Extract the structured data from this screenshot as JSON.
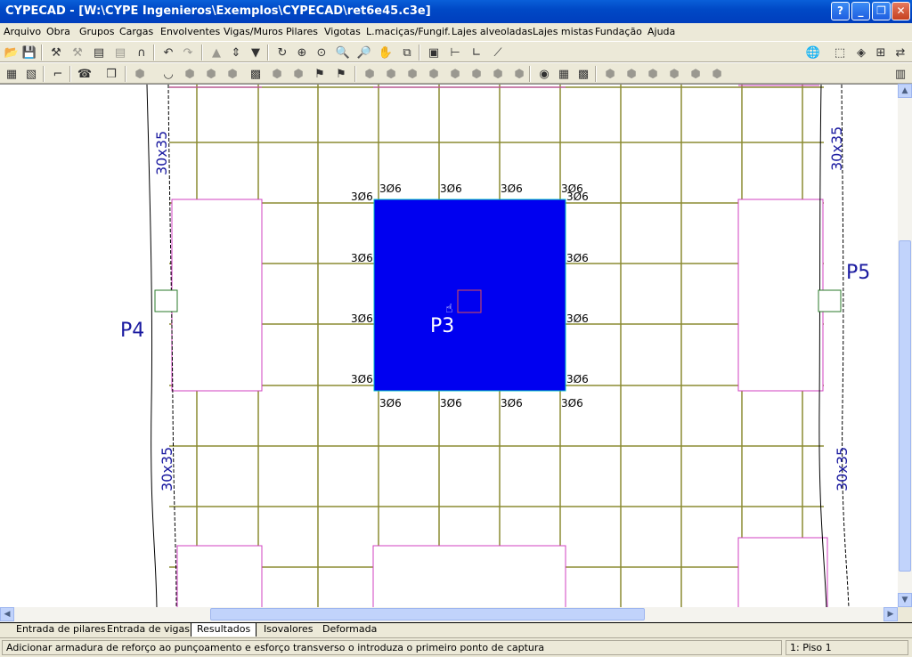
{
  "window": {
    "title": "CYPECAD - [W:\\CYPE Ingenieros\\Exemplos\\CYPECAD\\ret6e45.c3e]",
    "help_label": "?",
    "min_label": "_",
    "restore_label": "❐",
    "close_label": "✕"
  },
  "menu": [
    "Arquivo",
    "Obra",
    "Grupos",
    "Cargas",
    "Envolventes",
    "Vigas/Muros",
    "Pilares",
    "Vigotas",
    "L.maciças/Fungif.",
    "Lajes alveoladas",
    "Lajes mistas",
    "Fundação",
    "Ajuda"
  ],
  "drawing": {
    "pillars": [
      {
        "label": "P3"
      },
      {
        "label": "P4"
      },
      {
        "label": "P5"
      }
    ],
    "beam_labels": [
      "30x35",
      "30x35",
      "30x35",
      "30x35"
    ],
    "rebar_label": "3Ø6",
    "colors": {
      "background": "#ffffff",
      "grid": "#8b8b32",
      "slab_outline": "#d040c0",
      "selected_fill": "#0000f0",
      "pillar_text": "#1a1aa0",
      "pillar_box": "#2a7a2a",
      "beam_line": "#000000"
    }
  },
  "tabs": [
    "Entrada de pilares",
    "Entrada de vigas",
    "Resultados",
    "Isovalores",
    "Deformada"
  ],
  "active_tab": "Resultados",
  "status": {
    "message": "Adicionar armadura de reforço ao punçoamento e esforço transverso o introduza o primeiro ponto de captura",
    "floor": "1: Piso 1"
  }
}
